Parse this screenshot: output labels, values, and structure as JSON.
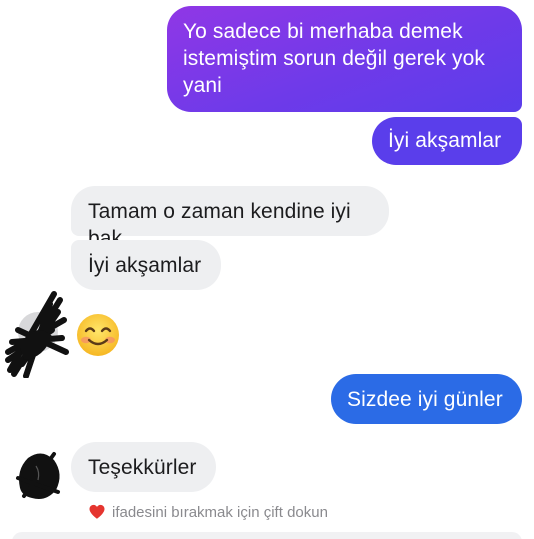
{
  "conversation": {
    "messages": [
      {
        "sender": "me",
        "text": "Yo sadece bi merhaba demek istemiştim sorun değil gerek yok yani"
      },
      {
        "sender": "me",
        "text": "İyi akşamlar"
      },
      {
        "sender": "them",
        "text": "Tamam o zaman kendine iyi bak"
      },
      {
        "sender": "them",
        "text": "İyi akşamlar"
      },
      {
        "sender": "them",
        "emoji": "smiling-face-emoji"
      },
      {
        "sender": "me",
        "text": "Sizdee iyi günler"
      },
      {
        "sender": "them",
        "text": "Teşekkürler"
      }
    ],
    "reaction_hint": {
      "icon": "heart-icon",
      "text": "ifadesini bırakmak için çift dokun"
    }
  },
  "colors": {
    "outgoing_gradient_start": "#9037e6",
    "outgoing_gradient_end": "#5a3deb",
    "outgoing_purple": "#5a3eeb",
    "outgoing_blue": "#2b6be6",
    "incoming_bg": "#eeeff1",
    "incoming_text": "#1c1c1e",
    "hint_text": "#8a8a8e",
    "heart": "#e5352f"
  }
}
